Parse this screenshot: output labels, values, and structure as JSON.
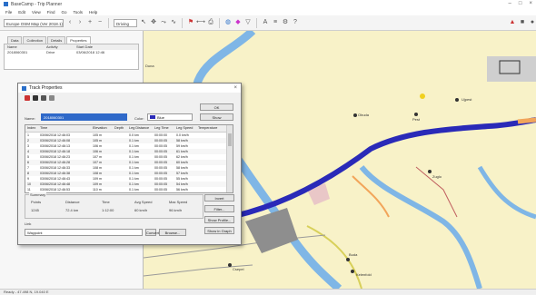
{
  "window": {
    "title": "BaseCamp - Trip Planner"
  },
  "menu": [
    "File",
    "Edit",
    "View",
    "Find",
    "Go",
    "Tools",
    "Help"
  ],
  "toolbar": {
    "map_combo": "Europe OSM Map (Ver 2018.1)",
    "activity_combo": "Driving",
    "icons": [
      "back-icon",
      "forward-icon",
      "select-icon",
      "zoom-in-icon",
      "zoom-out-icon",
      "pan-icon",
      "route-icon",
      "track-icon",
      "waypoint-icon",
      "measure-icon",
      "print-icon",
      "globe-icon",
      "settings-icon"
    ]
  },
  "left_panel": {
    "tabs": [
      "Data",
      "Collection",
      "Details",
      "Properties"
    ],
    "columns": [
      "Name",
      "Activity",
      "Start Date"
    ],
    "rows": [
      [
        "2018060301",
        "Drive",
        "03/06/2018 12:46"
      ]
    ]
  },
  "map": {
    "labels": [
      {
        "text": "Duna"
      },
      {
        "text": "Ujpest"
      },
      {
        "text": "Obuda"
      },
      {
        "text": "Pest"
      },
      {
        "text": "Buda"
      },
      {
        "text": "Kelenfold"
      },
      {
        "text": "Zuglo"
      },
      {
        "text": "Csepel"
      }
    ]
  },
  "dialog": {
    "title": "Track Properties",
    "ok": "OK",
    "name_label": "Name:",
    "name_value": "2018060301",
    "color_label": "Color:",
    "color_value": "Blue",
    "show_label": "Show",
    "columns": [
      "Index",
      "Time",
      "Elevation",
      "Depth",
      "Leg Distance",
      "Leg Time",
      "Leg Speed",
      "Temperature"
    ],
    "rows": [
      [
        "1",
        "03/06/2018 12:46:03",
        "105 m",
        "",
        "0.0 km",
        "00:00:00",
        "0.0 km/h",
        ""
      ],
      [
        "2",
        "03/06/2018 12:46:08",
        "105 m",
        "",
        "0.1 km",
        "00:00:05",
        "58 km/h",
        ""
      ],
      [
        "3",
        "03/06/2018 12:46:13",
        "106 m",
        "",
        "0.1 km",
        "00:00:05",
        "59 km/h",
        ""
      ],
      [
        "4",
        "03/06/2018 12:46:18",
        "106 m",
        "",
        "0.1 km",
        "00:00:05",
        "61 km/h",
        ""
      ],
      [
        "5",
        "03/06/2018 12:46:23",
        "107 m",
        "",
        "0.1 km",
        "00:00:05",
        "62 km/h",
        ""
      ],
      [
        "6",
        "03/06/2018 12:46:28",
        "107 m",
        "",
        "0.1 km",
        "00:00:05",
        "60 km/h",
        ""
      ],
      [
        "7",
        "03/06/2018 12:46:33",
        "108 m",
        "",
        "0.1 km",
        "00:00:05",
        "58 km/h",
        ""
      ],
      [
        "8",
        "03/06/2018 12:46:38",
        "108 m",
        "",
        "0.1 km",
        "00:00:05",
        "57 km/h",
        ""
      ],
      [
        "9",
        "03/06/2018 12:46:43",
        "109 m",
        "",
        "0.1 km",
        "00:00:05",
        "55 km/h",
        ""
      ],
      [
        "10",
        "03/06/2018 12:46:48",
        "109 m",
        "",
        "0.1 km",
        "00:00:05",
        "54 km/h",
        ""
      ],
      [
        "11",
        "03/06/2018 12:46:53",
        "110 m",
        "",
        "0.1 km",
        "00:00:05",
        "56 km/h",
        ""
      ]
    ],
    "group_label": "Summary",
    "summary": [
      {
        "label": "Points",
        "value": "1245"
      },
      {
        "label": "Distance",
        "value": "72.4 km"
      },
      {
        "label": "Time",
        "value": "1:12:00"
      },
      {
        "label": "Avg Speed",
        "value": "60 km/h"
      },
      {
        "label": "Max Speed",
        "value": "96 km/h"
      }
    ],
    "btn_invert": "Invert",
    "btn_filter": "Filter...",
    "btn_profile": "Show Profile...",
    "btn_graph": "Show in Graph",
    "btn_convert": "Convert",
    "link_label": "Link",
    "link_value": "Waypoint",
    "btn_browse": "Browse..."
  },
  "statusbar": {
    "text": "Ready - 47.498 N, 19.040 E"
  },
  "colors": {
    "track": "#2a2ab8",
    "river": "#7fb6e6",
    "land": "#f8f2c8",
    "road": "#f2a55a"
  }
}
